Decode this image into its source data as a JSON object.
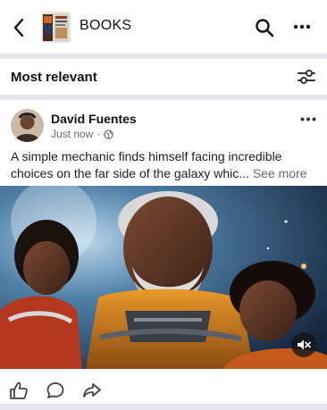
{
  "header": {
    "title": "BOOKS",
    "back_icon": "chevron-left-icon",
    "search_icon": "search-icon",
    "more_icon": "more-horizontal-icon"
  },
  "sort": {
    "label": "Most relevant",
    "filter_icon": "sliders-icon"
  },
  "post": {
    "author": "David Fuentes",
    "time": "Just now",
    "separator": "·",
    "audience_icon": "globe-icon",
    "text": "A simple mechanic finds himself facing incredible choices on the far side of the galaxy whic...",
    "see_more": "See more",
    "media_icon": "mute-icon",
    "actions": [
      "like-icon",
      "comment-icon",
      "share-icon"
    ]
  },
  "colors": {
    "divider": "#e4e6eb",
    "secondary_text": "#65676b",
    "primary_text": "#1c1e21"
  }
}
